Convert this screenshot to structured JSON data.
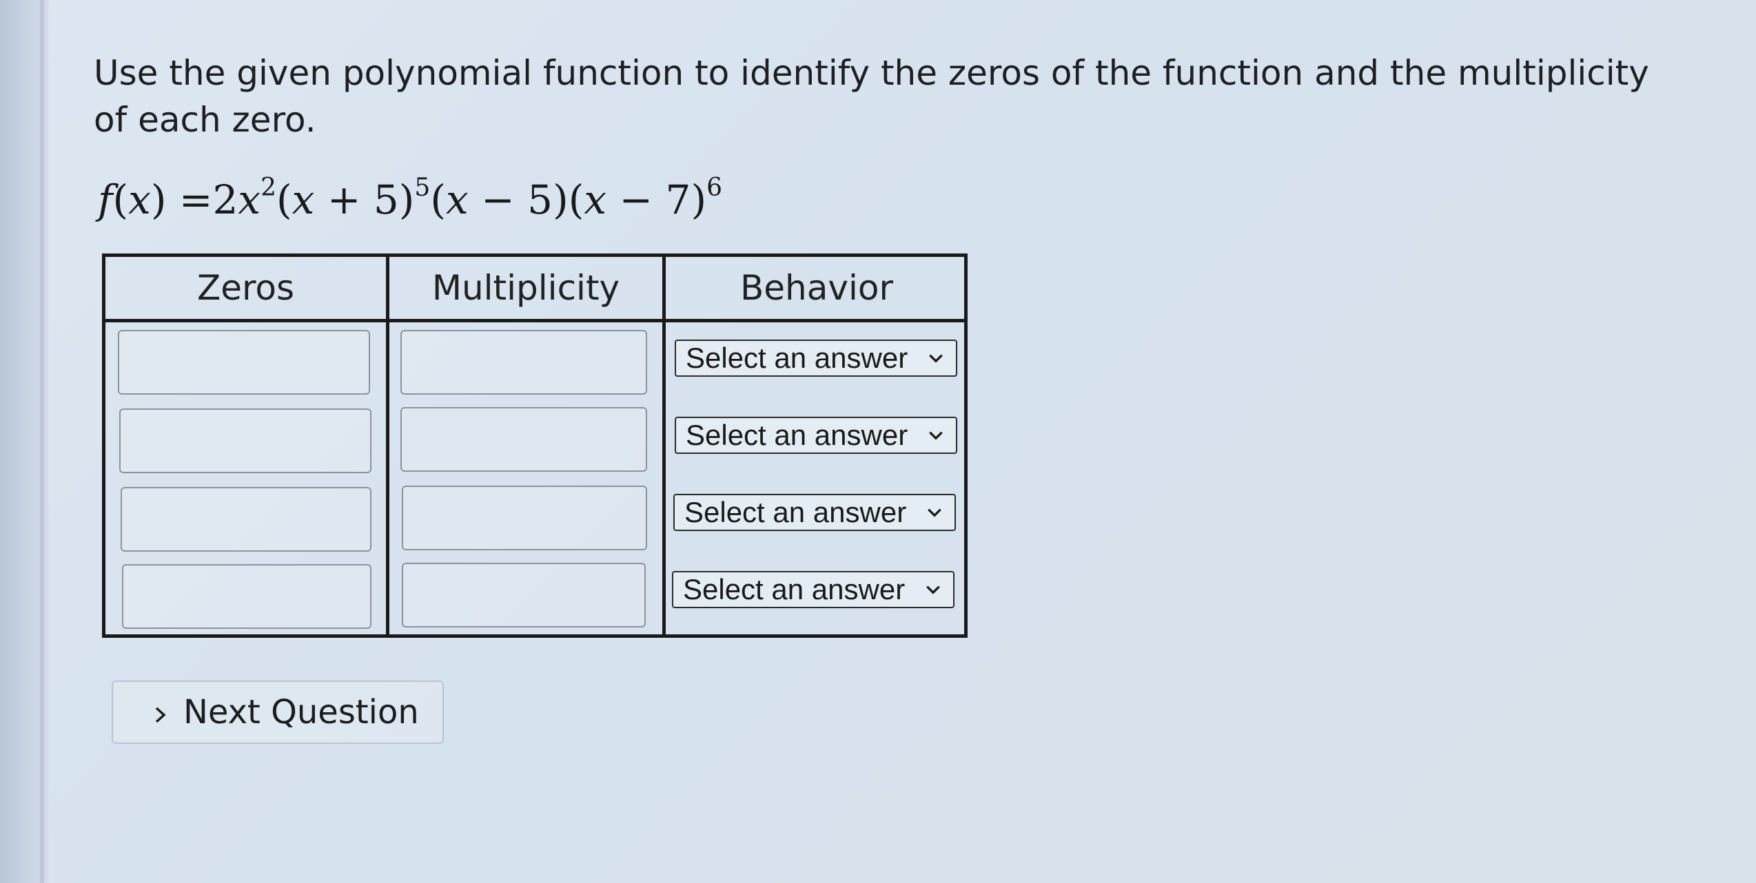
{
  "question": {
    "prompt": "Use the given polynomial function to identify the zeros of the function and the multiplicity of each zero."
  },
  "formula": {
    "f": "f",
    "x": "x",
    "coef": "2",
    "exp1": "2",
    "exp2": "5",
    "exp4": "6",
    "term2_const": "5",
    "term3_const": "5",
    "term4_const": "7"
  },
  "table": {
    "headers": [
      "Zeros",
      "Multiplicity",
      "Behavior"
    ],
    "rows": [
      {
        "zero": "",
        "multiplicity": "",
        "behavior": "Select an answer"
      },
      {
        "zero": "",
        "multiplicity": "",
        "behavior": "Select an answer"
      },
      {
        "zero": "",
        "multiplicity": "",
        "behavior": "Select an answer"
      },
      {
        "zero": "",
        "multiplicity": "",
        "behavior": "Select an answer"
      }
    ]
  },
  "next_button": {
    "label": "Next Question"
  },
  "icons": {
    "dropdown": "chevron-down-icon",
    "next": "chevron-right-icon"
  }
}
